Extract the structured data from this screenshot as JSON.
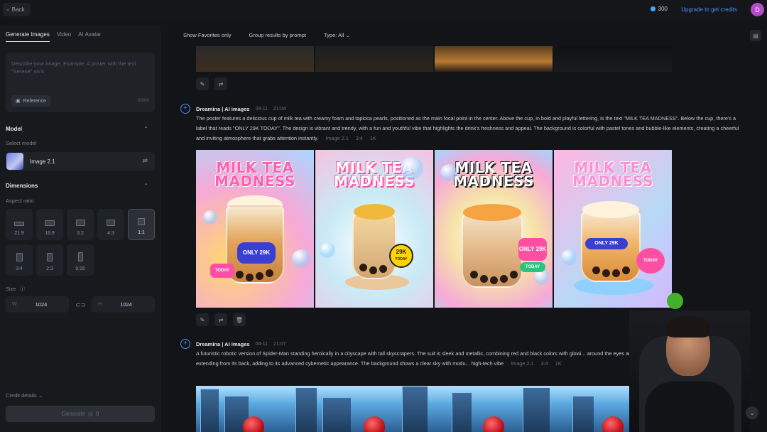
{
  "topbar": {
    "back_label": "Back",
    "credits_value": "300",
    "upgrade_label": "Upgrade to get credits",
    "avatar_initial": "D"
  },
  "left": {
    "tabs": [
      "Generate Images",
      "Video",
      "AI Avatar"
    ],
    "prompt_placeholder": "Describe your image. Example: A poster with the text \"Serene\" on it",
    "reference_label": "Reference",
    "char_count": "0/800",
    "model_title": "Model",
    "select_model_label": "Select model",
    "model_name": "Image 2.1",
    "dimensions_title": "Dimensions",
    "aspect_ratio_label": "Aspect ratio",
    "ratios": [
      "21:9",
      "16:9",
      "3:2",
      "4:3",
      "1:1",
      "3:4",
      "2:3",
      "9:16"
    ],
    "selected_ratio": "1:1",
    "size_label": "Size",
    "width_letter": "W",
    "width_value": "1024",
    "height_letter": "H",
    "height_value": "1024",
    "credit_details_label": "Credit details",
    "generate_label": "Generate",
    "generate_cost": "0"
  },
  "toolbar": {
    "show_favorites": "Show Favorites only",
    "group_results": "Group results by prompt",
    "type_filter": "Type: All"
  },
  "generations": [
    {
      "title": "Dreamina | AI images",
      "date": "04-11",
      "time": "21:04",
      "prompt": "The poster features a delicious cup of milk tea with creamy foam and tapioca pearls, positioned as the main focal point in the center. Above the cup, in bold and playful lettering, is the text \"MILK TEA MADNESS\". Below the cup, there's a label that reads \"ONLY 29K TODAY\". The design is vibrant and trendy, with a fun and youthful vibe that highlights the drink's freshness and appeal. The background is colorful with pastel tones and bubble-like elements, creating a cheerful and inviting atmosphere that grabs attention instantly.",
      "model": "Image 2.1",
      "ratio": "3:4",
      "resolution": "1K"
    },
    {
      "title": "Dreamina | AI images",
      "date": "04-11",
      "time": "21:07",
      "prompt": "A futuristic robotic version of Spider-Man standing heroically in a cityscape with tall skyscrapers. The suit is sleek and metallic, combining red and black colors with glowi... around the eyes and chest. The robot has mechanical arms extending from its back, adding to its advanced cybernetic appearance. The background shows a clear sky with modu... high-tech vibe",
      "model": "Image 2.1",
      "ratio": "3:4",
      "resolution": "1K"
    }
  ],
  "posters": [
    {
      "title": "MILK TEA MADNESS",
      "price": "ONLY 29K",
      "tag": "TODAY",
      "bg": "#f6c2e0",
      "title_color": "#ff5fae"
    },
    {
      "title": "MILK TEA MADNESS",
      "price": "29K",
      "tag": "TODAY",
      "bg": "#c9eaf6",
      "title_color": "#ffffff"
    },
    {
      "title": "MILK TEA MADNESS",
      "price": "ONLY 29K",
      "tag": "TODAY",
      "bg": "#f6e3a8",
      "title_color": "#ffffff"
    },
    {
      "title": "MILK TEA MADNESS",
      "price": "ONLY 29K",
      "tag": "TODAY",
      "bg": "#b9d8f6",
      "title_color": "#ff8fd0"
    }
  ],
  "colors": {
    "accent": "#4b8df8",
    "panel": "#17191d",
    "background": "#121417"
  }
}
